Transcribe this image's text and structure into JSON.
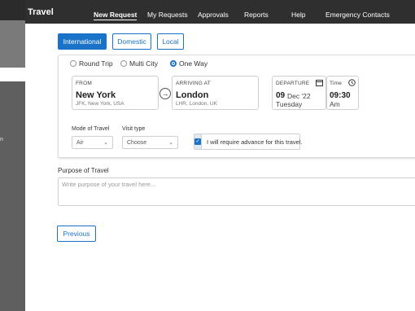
{
  "app": {
    "title": "Travel"
  },
  "nav": [
    {
      "label": "New Request",
      "active": true
    },
    {
      "label": "My Requests"
    },
    {
      "label": "Approvals"
    },
    {
      "label": "Reports"
    },
    {
      "label": "Help"
    },
    {
      "label": "Emergency Contacts"
    }
  ],
  "rail": {
    "glyph": "n"
  },
  "tabs": [
    {
      "label": "International",
      "selected": true
    },
    {
      "label": "Domestic"
    },
    {
      "label": "Local"
    }
  ],
  "trip_type": [
    {
      "label": "Round Trip",
      "selected": false
    },
    {
      "label": "Multi City",
      "selected": false
    },
    {
      "label": "One Way",
      "selected": true
    }
  ],
  "from": {
    "label": "FROM",
    "city": "New York",
    "detail": "JFK, New York, USA"
  },
  "to": {
    "label": "ARRIVING AT",
    "city": "London",
    "detail": "LHR, London, UK"
  },
  "departure": {
    "label": "DEPARTURE",
    "day": "09",
    "month_year": "Dec '22",
    "weekday": "Tuesday"
  },
  "time": {
    "label": "Time",
    "value": "09:30",
    "period": "Am"
  },
  "mode": {
    "label": "Mode of Travel",
    "value": "Air"
  },
  "visit": {
    "label": "Visit type",
    "value": "Choose"
  },
  "advance": {
    "label": "I will require advance for this travel.",
    "checked": true
  },
  "purpose": {
    "label": "Purpose of Travel",
    "placeholder": "Write purpose of your travel here..."
  },
  "buttons": {
    "previous": "Previous"
  },
  "colors": {
    "accent": "#1a73c9",
    "nav_bg": "#2f2f2f",
    "rail_bg": "#5f5f5f"
  }
}
